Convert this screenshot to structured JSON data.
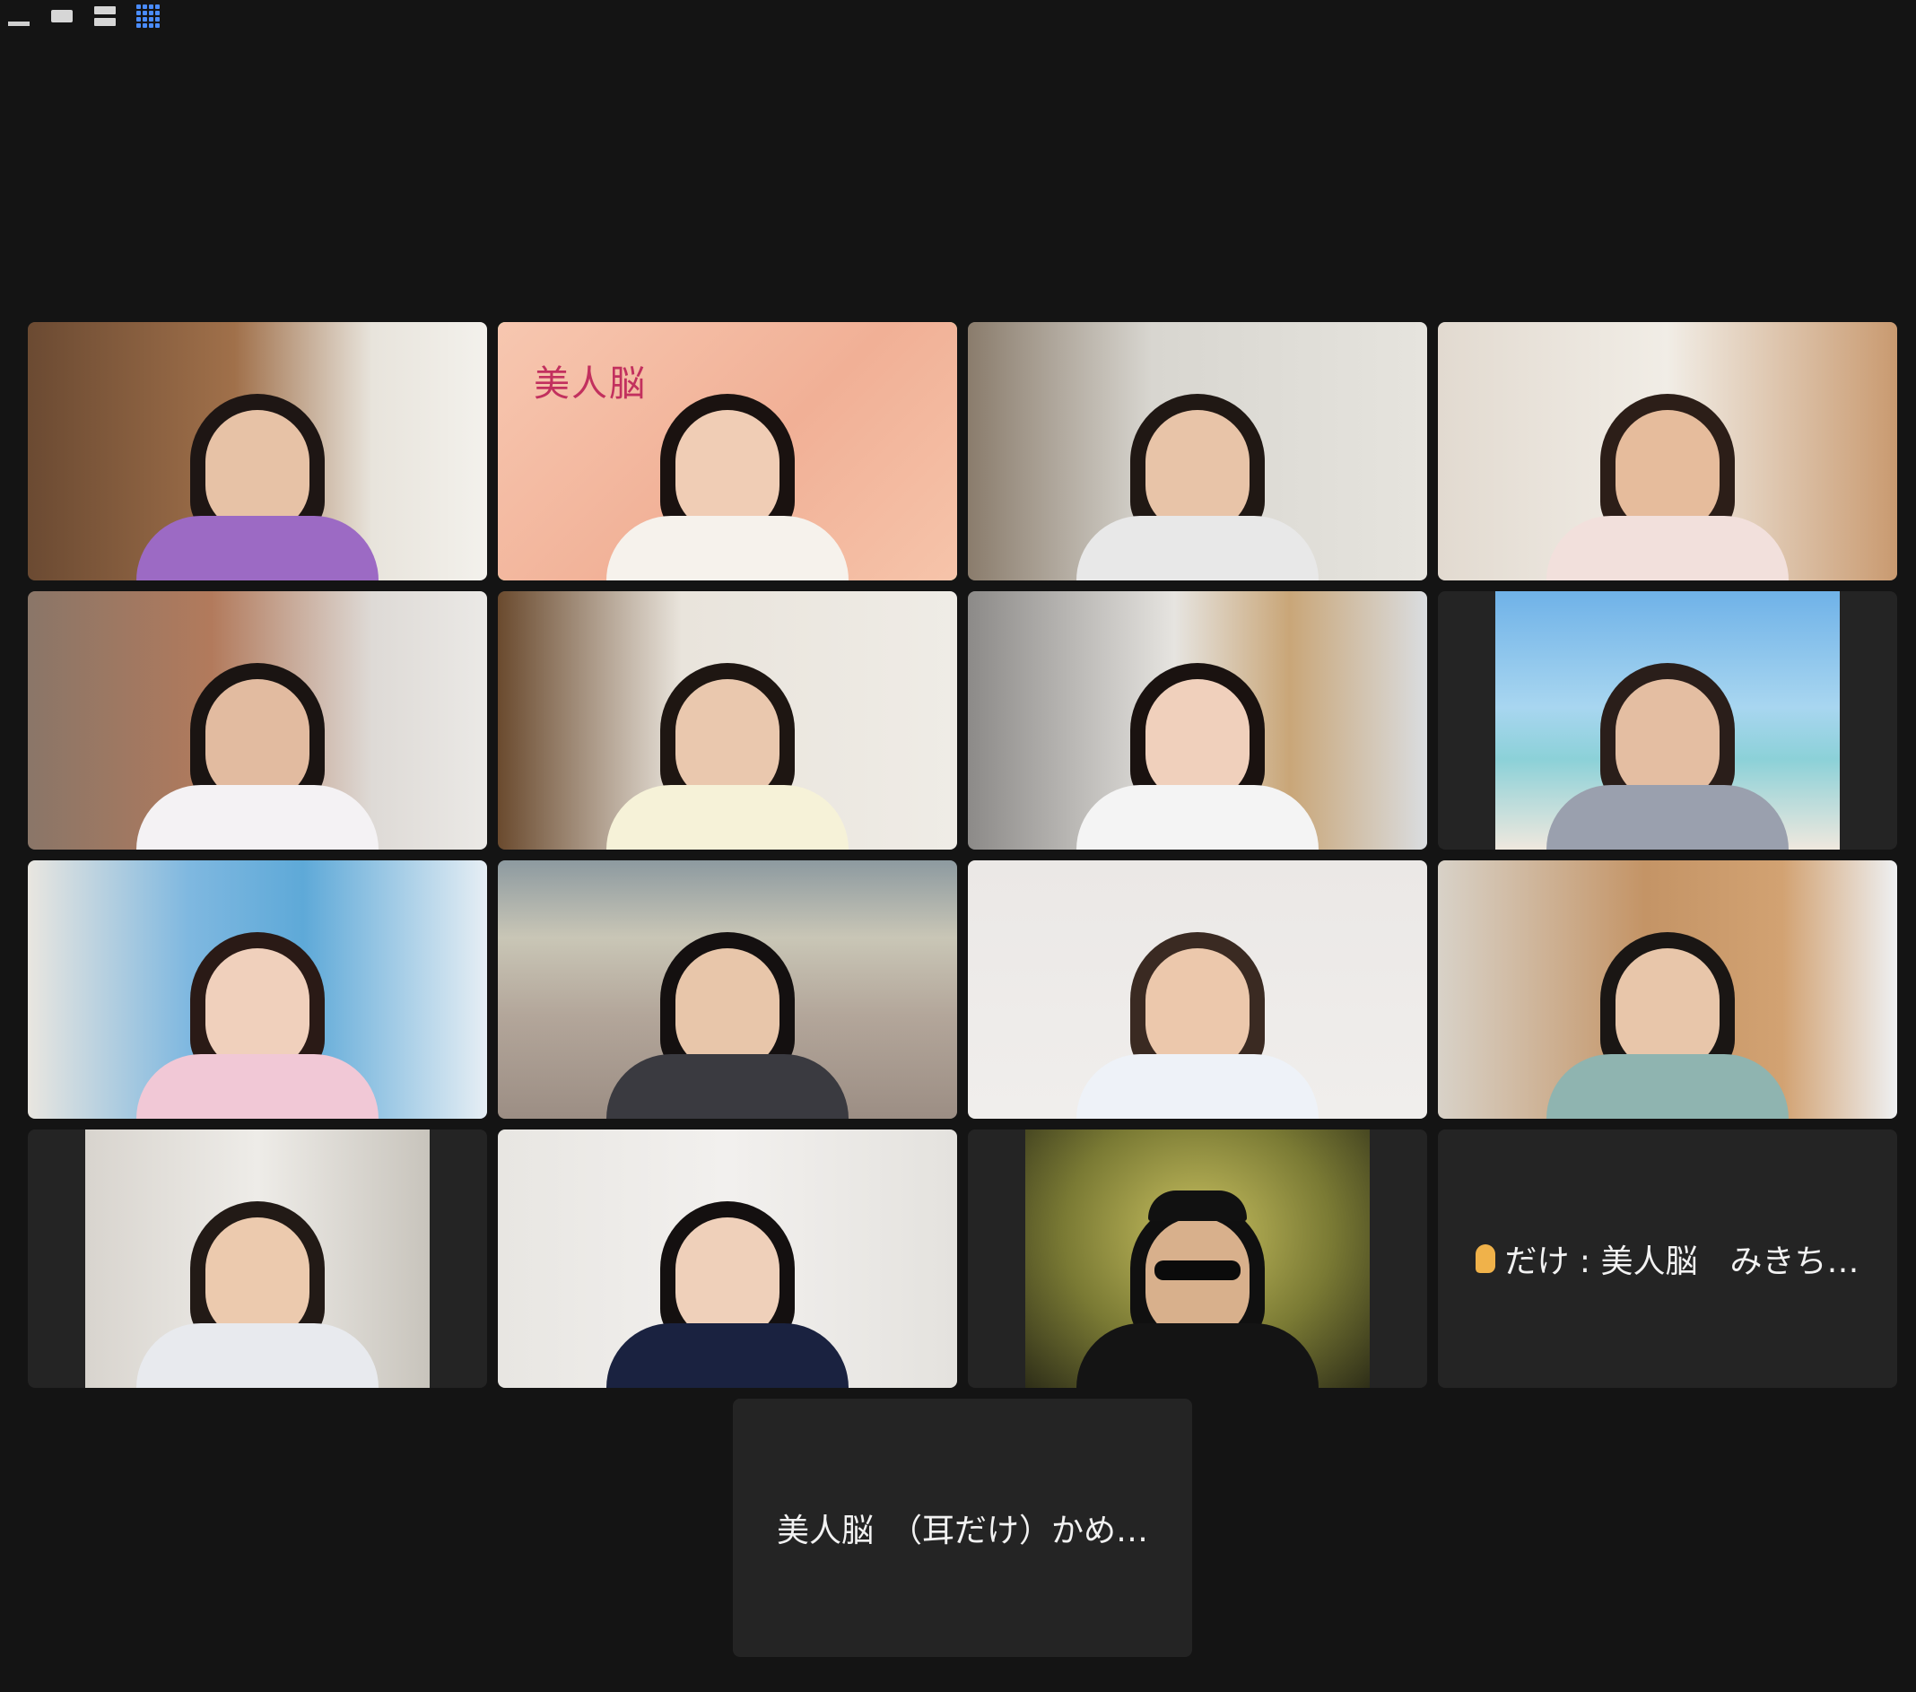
{
  "toolbar": {
    "buttons": [
      {
        "icon": "minimize-icon"
      },
      {
        "icon": "speaker-strip-view-icon"
      },
      {
        "icon": "speaker-stack-view-icon"
      },
      {
        "icon": "gallery-view-icon",
        "active": true
      }
    ],
    "accent_color": "#4a8cff"
  },
  "gallery": {
    "columns": 4,
    "active_speaker_color": "#5fd35a",
    "video_tiles": [
      {
        "id": 1,
        "skin": "#e7c2a6",
        "hair": "#1e1614",
        "shirt": "#9c6ac4",
        "bg": "linear-gradient(90deg,#6b4a32 0%,#a0704a 45%,#e8e4dc 75%,#f3f1ec 100%)"
      },
      {
        "id": 2,
        "skin": "#f0cdb5",
        "hair": "#1a1210",
        "shirt": "#f6f2ec",
        "bg": "linear-gradient(135deg,#f7c7b0 0%,#f1b096 55%,#f6c4aa 100%)",
        "active": true,
        "logo": "美人脳"
      },
      {
        "id": 3,
        "skin": "#e8c4a8",
        "hair": "#201814",
        "shirt": "#e8e8e8",
        "bg": "linear-gradient(90deg,#8a7c6c 0%,#d8d6d0 40%,#e6e4de 100%)"
      },
      {
        "id": 4,
        "skin": "#e6bc9c",
        "hair": "#2c1e18",
        "shirt": "#f2e0dc",
        "bg": "linear-gradient(90deg,#e2dad0 0%,#f1ede6 50%,#c99a70 100%)"
      },
      {
        "id": 5,
        "skin": "#e2bba0",
        "hair": "#1a1412",
        "shirt": "#f4f2f4",
        "bg": "linear-gradient(90deg,#8a7668 0%,#b27a5c 40%,#dedad6 75%,#ebe9e6 100%)"
      },
      {
        "id": 6,
        "skin": "#eac8ae",
        "hair": "#1e1612",
        "shirt": "#f6f2d8",
        "bg": "linear-gradient(90deg,#6a4a2e 0%,#e9e4dc 40%,#efece6 100%)"
      },
      {
        "id": 7,
        "skin": "#f0d0bc",
        "hair": "#1a1210",
        "shirt": "#f4f4f4",
        "bg": "linear-gradient(90deg,#8c8a88 0%,#e6e4e0 45%,#c9a678 70%,#dadde0 100%)"
      },
      {
        "id": 8,
        "skin": "#e4bea2",
        "hair": "#2a1e1a",
        "shirt": "#9aa0ae",
        "bg": "linear-gradient(180deg,#6fb2e8 0%,#a8d6f0 45%,#8cd1d8 65%,#efe8de 100%)",
        "narrow": true
      },
      {
        "id": 9,
        "skin": "#f0d0bc",
        "hair": "#2a1a16",
        "shirt": "#f1c8d6",
        "bg": "linear-gradient(90deg,#e9e6e0 0%,#7fb8e0 35%,#5ea9d8 60%,#e6eef4 100%)"
      },
      {
        "id": 10,
        "skin": "#e8c6aa",
        "hair": "#141010",
        "shirt": "#3a3a40",
        "bg": "linear-gradient(180deg,#8d9aa0 0%,#c9c6b6 30%,#b3a69a 60%,#9c8e84 100%)"
      },
      {
        "id": 11,
        "skin": "#ecc8ac",
        "hair": "#3a2a22",
        "shirt": "#eef2f8",
        "bg": "linear-gradient(180deg,#ebe8e6 0%,#f0eeec 100%)"
      },
      {
        "id": 12,
        "skin": "#e8c6aa",
        "hair": "#1a1614",
        "shirt": "#8fb4b0",
        "bg": "linear-gradient(90deg,#d8d2c8 0%,#c49466 45%,#d2a272 75%,#eef0f2 100%)"
      },
      {
        "id": 13,
        "skin": "#eccaae",
        "hair": "#221a16",
        "shirt": "#e8eaee",
        "bg": "linear-gradient(90deg,#d8d4ce 0%,#eeece8 50%,#c8c4bc 100%)",
        "narrow": true
      },
      {
        "id": 14,
        "skin": "#efd0ba",
        "hair": "#141010",
        "shirt": "#1a2240",
        "bg": "linear-gradient(90deg,#e8e6e2 0%,#f2f0ee 50%,#e4e2de 100%)"
      },
      {
        "id": 15,
        "skin": "#d8b08c",
        "hair": "#101010",
        "shirt": "#141414",
        "bg": "radial-gradient(ellipse at 50% 40%,#c8c060 0%,#7a7a34 55%,#2e2e18 100%)",
        "narrow": true,
        "hat": true
      }
    ],
    "audio_tiles": [
      {
        "id": 16,
        "icon": "ear-icon",
        "label": "だけ : 美人脳　みきち…"
      }
    ]
  },
  "bottom_row": {
    "tiles": [
      {
        "id": 17,
        "label": "美人脳　（耳だけ）かめ…"
      }
    ]
  }
}
